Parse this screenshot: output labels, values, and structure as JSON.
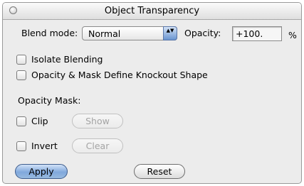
{
  "window": {
    "title": "Object Transparency"
  },
  "blend": {
    "label": "Blend mode:",
    "value": "Normal",
    "arrows": "▲▼"
  },
  "opacity": {
    "label": "Opacity:",
    "value": "+100.",
    "unit": "%"
  },
  "options": {
    "isolate": {
      "label": "Isolate Blending",
      "checked": false
    },
    "knockout": {
      "label": "Opacity & Mask Define Knockout Shape",
      "checked": false
    }
  },
  "mask": {
    "heading": "Opacity Mask:",
    "clip": {
      "label": "Clip",
      "checked": false
    },
    "show_label": "Show",
    "invert": {
      "label": "Invert",
      "checked": false
    },
    "clear_label": "Clear"
  },
  "buttons": {
    "apply_label": "Apply",
    "reset_label": "Reset"
  },
  "colors": {
    "default_button": "#80a8dc",
    "window_bg": "#ececec"
  }
}
